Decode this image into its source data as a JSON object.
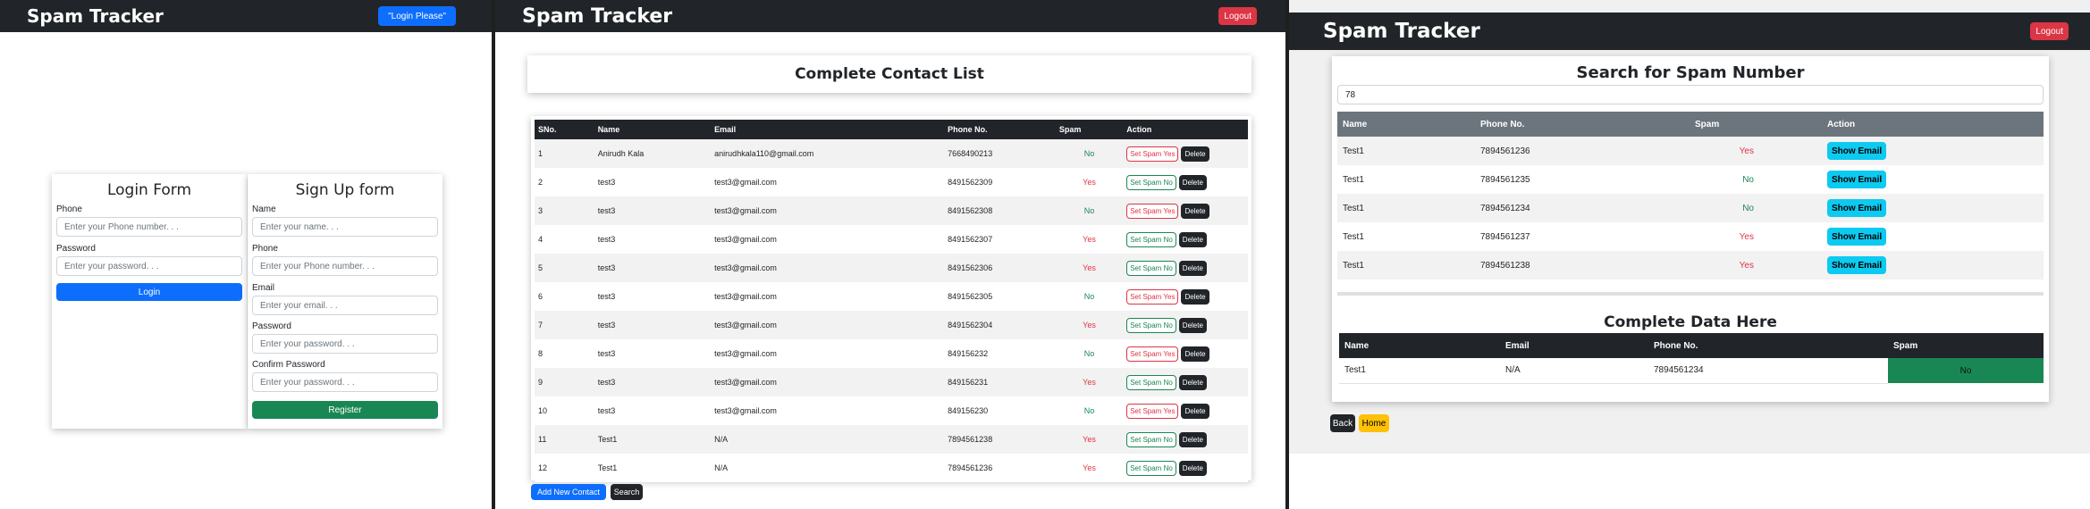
{
  "login_page": {
    "brand": "Spam Tracker",
    "login_please_button": "\"Login Please\"",
    "login_form": {
      "title": "Login Form",
      "phone_label": "Phone",
      "phone_placeholder": "Enter your Phone number. . .",
      "password_label": "Password",
      "password_placeholder": "Enter your password. . .",
      "submit_label": "Login"
    },
    "signup_form": {
      "title": "Sign Up form",
      "name_label": "Name",
      "name_placeholder": "Enter your name. . .",
      "phone_label": "Phone",
      "phone_placeholder": "Enter your Phone number. . .",
      "email_label": "Email",
      "email_placeholder": "Enter your email. . .",
      "password_label": "Password",
      "password_placeholder": "Enter your password. . .",
      "confirm_label": "Confirm Password",
      "confirm_placeholder": "Enter your password. . .",
      "submit_label": "Register"
    }
  },
  "contacts_page": {
    "brand": "Spam Tracker",
    "logout_label": "Logout",
    "title": "Complete Contact List",
    "columns": [
      "SNo.",
      "Name",
      "Email",
      "Phone No.",
      "Spam",
      "Action"
    ],
    "rows": [
      {
        "sno": "1",
        "name": "Anirudh Kala",
        "email": "anirudhkala110@gmail.com",
        "phone": "7668490213",
        "spam": "No",
        "toggle": "Set Spam Yes",
        "delete": "Delete"
      },
      {
        "sno": "2",
        "name": "test3",
        "email": "test3@gmail.com",
        "phone": "8491562309",
        "spam": "Yes",
        "toggle": "Set Spam No",
        "delete": "Delete"
      },
      {
        "sno": "3",
        "name": "test3",
        "email": "test3@gmail.com",
        "phone": "8491562308",
        "spam": "No",
        "toggle": "Set Spam Yes",
        "delete": "Delete"
      },
      {
        "sno": "4",
        "name": "test3",
        "email": "test3@gmail.com",
        "phone": "8491562307",
        "spam": "Yes",
        "toggle": "Set Spam No",
        "delete": "Delete"
      },
      {
        "sno": "5",
        "name": "test3",
        "email": "test3@gmail.com",
        "phone": "8491562306",
        "spam": "Yes",
        "toggle": "Set Spam No",
        "delete": "Delete"
      },
      {
        "sno": "6",
        "name": "test3",
        "email": "test3@gmail.com",
        "phone": "8491562305",
        "spam": "No",
        "toggle": "Set Spam Yes",
        "delete": "Delete"
      },
      {
        "sno": "7",
        "name": "test3",
        "email": "test3@gmail.com",
        "phone": "8491562304",
        "spam": "Yes",
        "toggle": "Set Spam No",
        "delete": "Delete"
      },
      {
        "sno": "8",
        "name": "test3",
        "email": "test3@gmail.com",
        "phone": "849156232",
        "spam": "No",
        "toggle": "Set Spam Yes",
        "delete": "Delete"
      },
      {
        "sno": "9",
        "name": "test3",
        "email": "test3@gmail.com",
        "phone": "849156231",
        "spam": "Yes",
        "toggle": "Set Spam No",
        "delete": "Delete"
      },
      {
        "sno": "10",
        "name": "test3",
        "email": "test3@gmail.com",
        "phone": "849156230",
        "spam": "No",
        "toggle": "Set Spam Yes",
        "delete": "Delete"
      },
      {
        "sno": "11",
        "name": "Test1",
        "email": "N/A",
        "phone": "7894561238",
        "spam": "Yes",
        "toggle": "Set Spam No",
        "delete": "Delete"
      },
      {
        "sno": "12",
        "name": "Test1",
        "email": "N/A",
        "phone": "7894561236",
        "spam": "Yes",
        "toggle": "Set Spam No",
        "delete": "Delete"
      }
    ],
    "add_contact_label": "Add New Contact",
    "search_label": "Search"
  },
  "search_page": {
    "brand": "Spam Tracker",
    "logout_label": "Logout",
    "title": "Search for Spam Number",
    "search_value": "78",
    "columns": [
      "Name",
      "Phone No.",
      "Spam",
      "Action"
    ],
    "rows": [
      {
        "name": "Test1",
        "phone": "7894561236",
        "spam": "Yes",
        "action": "Show Email"
      },
      {
        "name": "Test1",
        "phone": "7894561235",
        "spam": "No",
        "action": "Show Email"
      },
      {
        "name": "Test1",
        "phone": "7894561234",
        "spam": "No",
        "action": "Show Email"
      },
      {
        "name": "Test1",
        "phone": "7894561237",
        "spam": "Yes",
        "action": "Show Email"
      },
      {
        "name": "Test1",
        "phone": "7894561238",
        "spam": "Yes",
        "action": "Show Email"
      }
    ],
    "detail_title": "Complete Data Here",
    "detail_columns": [
      "Name",
      "Email",
      "Phone No.",
      "Spam"
    ],
    "detail_row": {
      "name": "Test1",
      "email": "N/A",
      "phone": "7894561234",
      "spam": "No"
    },
    "back_label": "Back",
    "home_label": "Home"
  },
  "colors": {
    "navbar": "#212529",
    "primary": "#0d6efd",
    "danger": "#dc3545",
    "success": "#198754",
    "info": "#0dcaf0",
    "warning": "#ffc107"
  }
}
